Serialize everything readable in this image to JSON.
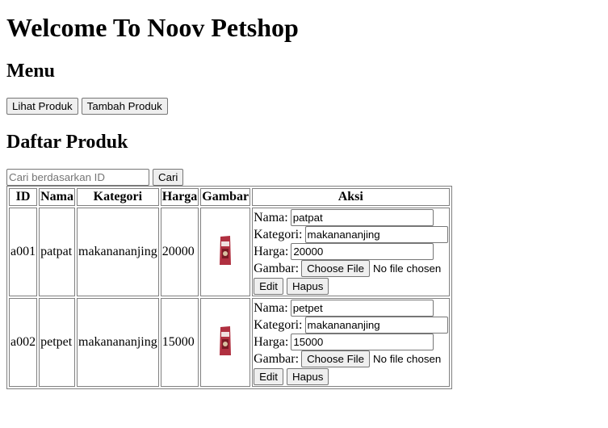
{
  "header": {
    "title": "Welcome To Noov Petshop"
  },
  "menu": {
    "heading": "Menu",
    "lihat_label": "Lihat Produk",
    "tambah_label": "Tambah Produk"
  },
  "daftar": {
    "heading": "Daftar Produk",
    "search_placeholder": "Cari berdasarkan ID",
    "search_button": "Cari"
  },
  "table": {
    "headers": [
      "ID",
      "Nama",
      "Kategori",
      "Harga",
      "Gambar",
      "Aksi"
    ],
    "labels": {
      "nama": "Nama:",
      "kategori": "Kategori:",
      "harga": "Harga:",
      "gambar": "Gambar:",
      "choose_file": "Choose File",
      "no_file": "No file chosen",
      "edit": "Edit",
      "hapus": "Hapus"
    },
    "rows": [
      {
        "id": "a001",
        "nama": "patpat",
        "kategori": "makanananjing",
        "harga": "20000",
        "form_nama": "patpat",
        "form_kategori": "makanananjing",
        "form_harga": "20000"
      },
      {
        "id": "a002",
        "nama": "petpet",
        "kategori": "makanananjing",
        "harga": "15000",
        "form_nama": "petpet",
        "form_kategori": "makanananjing",
        "form_harga": "15000"
      }
    ]
  },
  "colors": {
    "product_bag": "#b03040",
    "button_bg": "#efefef",
    "border": "#808080"
  },
  "icons": {
    "product_image": "dog-food-bag-image"
  }
}
